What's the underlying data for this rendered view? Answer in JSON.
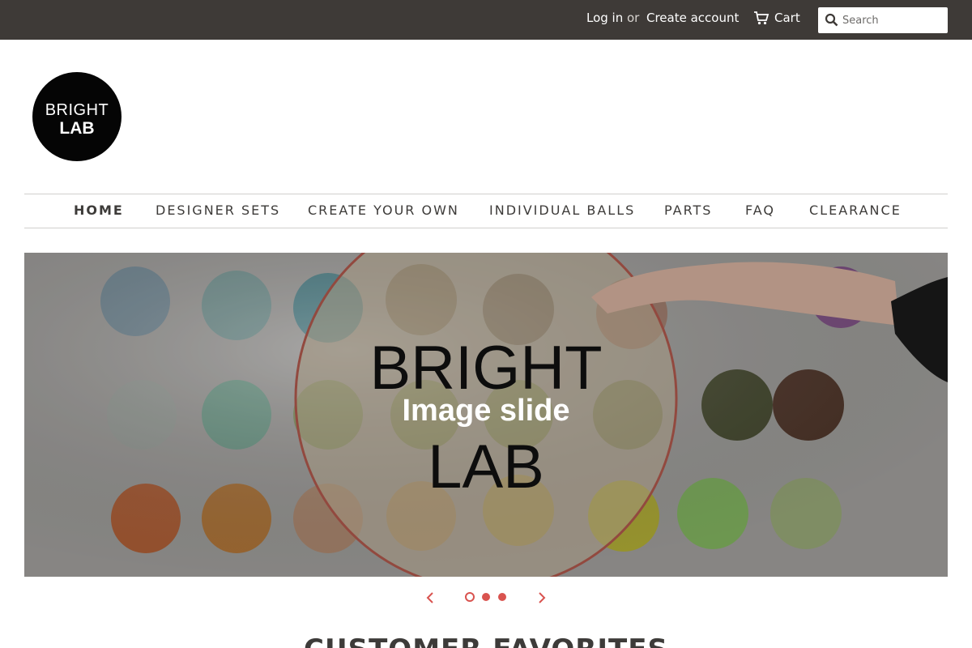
{
  "header": {
    "login_label": "Log in",
    "or_label": "or",
    "create_account_label": "Create account",
    "cart_label": "Cart",
    "search_placeholder": "Search"
  },
  "logo": {
    "line1": "BRIGHT",
    "line2": "LAB"
  },
  "nav": {
    "items": [
      {
        "label": "HOME",
        "active": true
      },
      {
        "label": "DESIGNER SETS"
      },
      {
        "label": "CREATE YOUR OWN"
      },
      {
        "label": "INDIVIDUAL BALLS"
      },
      {
        "label": "PARTS"
      },
      {
        "label": "FAQ"
      },
      {
        "label": "CLEARANCE"
      }
    ]
  },
  "slider": {
    "caption": "Image slide",
    "image_text_line1": "BRIGHT",
    "image_text_line2": "LAB",
    "slide_count": 3,
    "active_slide": 1
  },
  "section": {
    "title": "CUSTOMER FAVORITES"
  },
  "colors": {
    "topbar": "#3e3a37",
    "accent": "#d9534f",
    "text": "#3d3b39"
  },
  "icons": {
    "cart": "cart-icon",
    "search": "search-icon",
    "prev": "chevron-left-icon",
    "next": "chevron-right-icon"
  }
}
